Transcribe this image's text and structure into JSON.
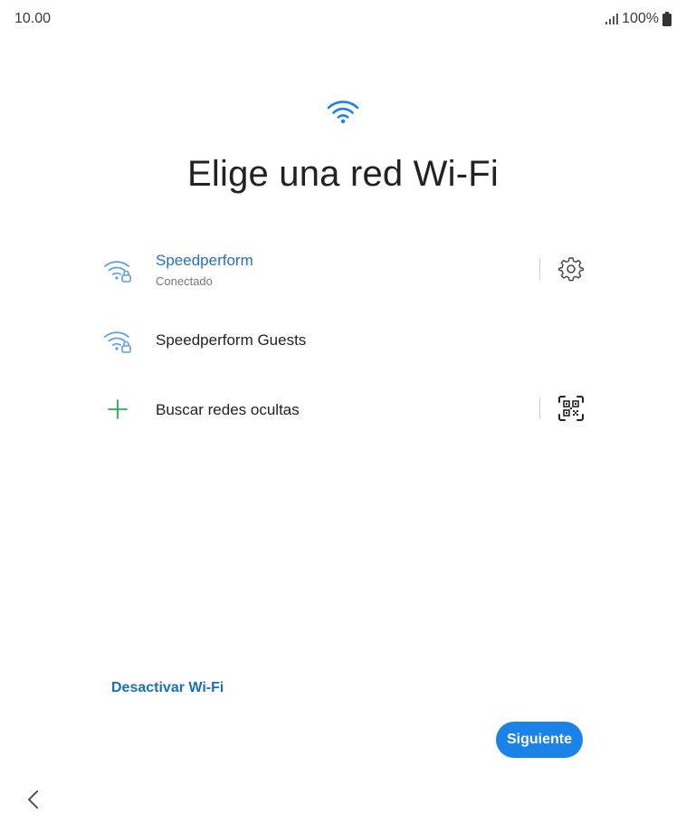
{
  "status_bar": {
    "time": "10.00",
    "battery": "100%"
  },
  "header": {
    "title": "Elige una red Wi-Fi",
    "icon": "wifi-icon"
  },
  "networks": [
    {
      "name": "Speedperform",
      "status": "Conectado",
      "icon": "wifi-lock-icon",
      "action_icon": "gear-icon"
    },
    {
      "name": "Speedperform Guests",
      "icon": "wifi-lock-icon"
    }
  ],
  "hidden_search": {
    "label": "Buscar redes ocultas",
    "icon": "plus-icon",
    "action_icon": "qr-code-icon"
  },
  "footer": {
    "disable_wifi_label": "Desactivar Wi-Fi",
    "next_label": "Siguiente",
    "back_icon": "chevron-left-icon"
  },
  "colors": {
    "accent": "#1b82e8",
    "link": "#1a6fc2",
    "connected_text": "#2471c4",
    "wifi_icon": "#5aa2e6",
    "plus_icon": "#2eaa55"
  }
}
